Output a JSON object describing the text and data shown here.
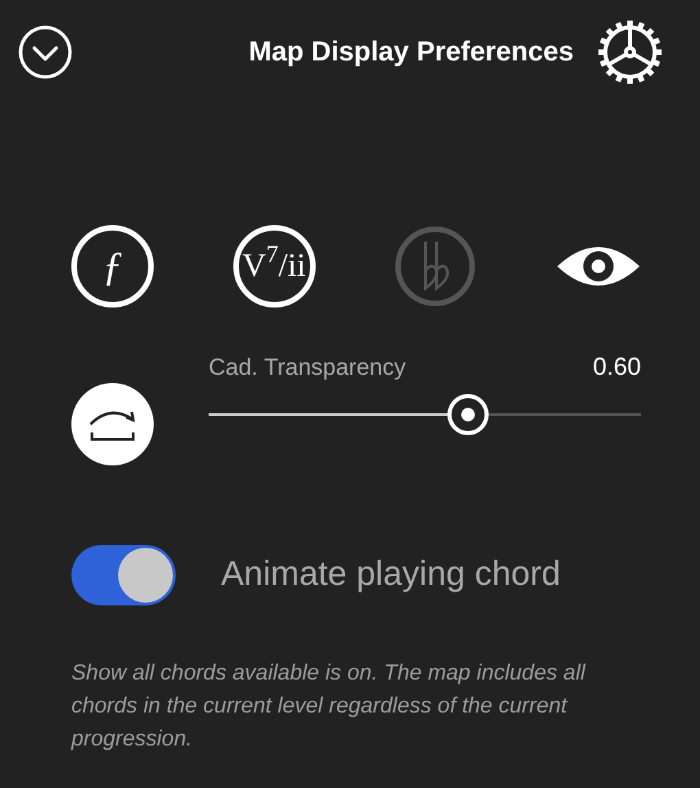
{
  "header": {
    "title": "Map Display Preferences"
  },
  "icon_buttons": [
    {
      "kind": "text",
      "label": "ƒ",
      "disabled": false
    },
    {
      "kind": "text",
      "label": "V$^{7}$/ii",
      "disabled": false
    },
    {
      "kind": "double-flat",
      "disabled": true
    },
    {
      "kind": "eye",
      "disabled": false
    }
  ],
  "transparency": {
    "label": "Cad. Transparency",
    "reading": "0.60",
    "level": 0.6
  },
  "animate": {
    "label": "Animate playing chord",
    "on": true
  },
  "note": "Show all chords available is on. The map includes all chords in the current level regardless of the current progression."
}
